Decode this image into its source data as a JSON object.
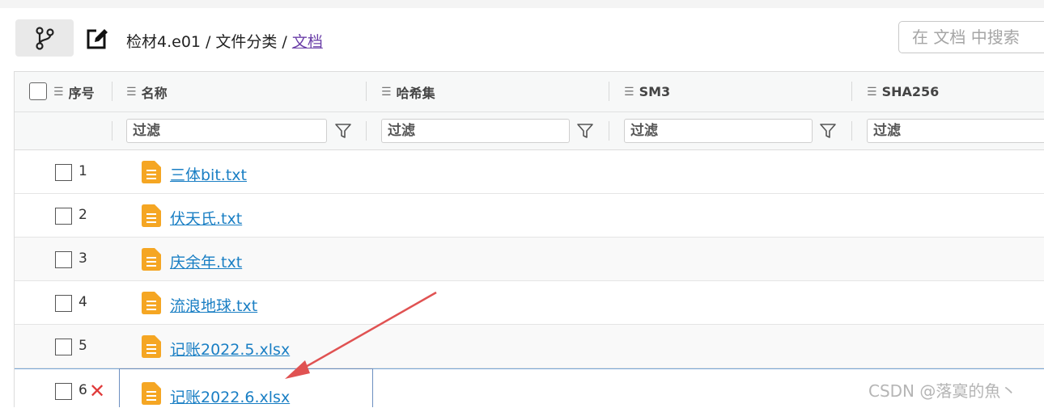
{
  "breadcrumb": {
    "root": "检材4.e01",
    "sep1": "/",
    "middle": "文件分类",
    "sep2": "/",
    "current": "文档"
  },
  "search": {
    "placeholder": "在 文档 中搜索"
  },
  "columns": {
    "index": "序号",
    "name": "名称",
    "hash": "哈希集",
    "sm3": "SM3",
    "sha256": "SHA256"
  },
  "filter": {
    "placeholder": "过滤"
  },
  "rows": [
    {
      "num": "1",
      "name": "三体bit.txt"
    },
    {
      "num": "2",
      "name": "伏天氏.txt"
    },
    {
      "num": "3",
      "name": "庆余年.txt"
    },
    {
      "num": "4",
      "name": "流浪地球.txt"
    },
    {
      "num": "5",
      "name": "记账2022.5.xlsx"
    },
    {
      "num": "6",
      "name": "记账2022.6.xlsx",
      "mark": "✕"
    }
  ],
  "watermark": "CSDN @落寞的魚丶",
  "colors": {
    "link": "#1a7fc4",
    "breadcrumb_current": "#6b3fa8",
    "file_icon": "#f5a623",
    "annotation": "#e03b3b"
  }
}
